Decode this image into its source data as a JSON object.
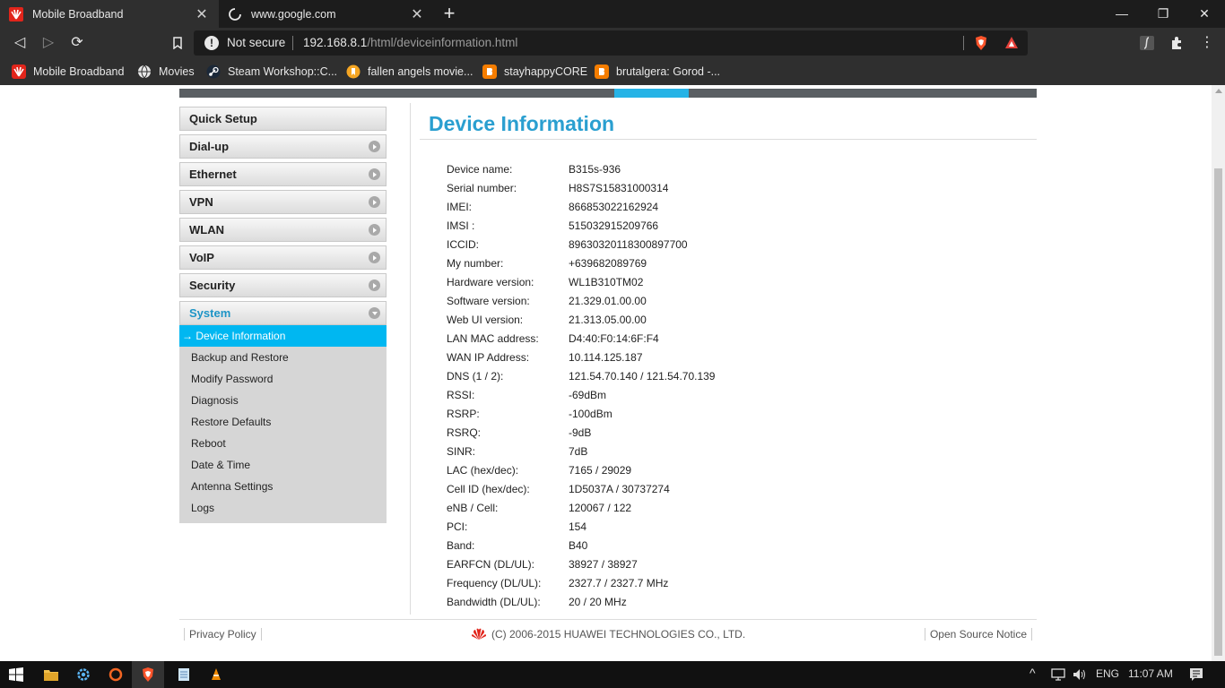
{
  "browser": {
    "tabs": [
      {
        "title": "Mobile Broadband",
        "active": true
      },
      {
        "title": "www.google.com",
        "active": false
      }
    ],
    "security_label": "Not secure",
    "url_host": "192.168.8.1",
    "url_path": "/html/deviceinformation.html",
    "bookmarks": [
      {
        "label": "Mobile Broadband",
        "icon": "huawei-icon"
      },
      {
        "label": "Movies",
        "icon": "globe-icon"
      },
      {
        "label": "Steam Workshop::C...",
        "icon": "steam-icon"
      },
      {
        "label": "fallen angels movie...",
        "icon": "bookmark-icon"
      },
      {
        "label": "stayhappyCORE",
        "icon": "blogger-icon"
      },
      {
        "label": "brutalgera: Gorod -...",
        "icon": "blogger-icon"
      }
    ]
  },
  "sidebar": {
    "items": [
      {
        "label": "Quick Setup"
      },
      {
        "label": "Dial-up"
      },
      {
        "label": "Ethernet"
      },
      {
        "label": "VPN"
      },
      {
        "label": "WLAN"
      },
      {
        "label": "VoIP"
      },
      {
        "label": "Security"
      },
      {
        "label": "System"
      }
    ],
    "active_marker": "→",
    "system_submenu": [
      {
        "label": "Device Information"
      },
      {
        "label": "Backup and Restore"
      },
      {
        "label": "Modify Password"
      },
      {
        "label": "Diagnosis"
      },
      {
        "label": "Restore Defaults"
      },
      {
        "label": "Reboot"
      },
      {
        "label": "Date & Time"
      },
      {
        "label": "Antenna Settings"
      },
      {
        "label": "Logs"
      }
    ]
  },
  "main": {
    "title": "Device Information",
    "rows": [
      {
        "label": "Device name:",
        "value": "B315s-936"
      },
      {
        "label": "Serial number:",
        "value": "H8S7S15831000314"
      },
      {
        "label": "IMEI:",
        "value": "866853022162924"
      },
      {
        "label": "IMSI :",
        "value": "515032915209766"
      },
      {
        "label": "ICCID:",
        "value": "89630320118300897700"
      },
      {
        "label": "My number:",
        "value": "+639682089769"
      },
      {
        "label": "Hardware version:",
        "value": "WL1B310TM02"
      },
      {
        "label": "Software version:",
        "value": "21.329.01.00.00"
      },
      {
        "label": "Web UI version:",
        "value": "21.313.05.00.00"
      },
      {
        "label": "LAN MAC address:",
        "value": "D4:40:F0:14:6F:F4"
      },
      {
        "label": "WAN IP Address:",
        "value": "10.114.125.187"
      },
      {
        "label": "DNS (1 / 2):",
        "value": "121.54.70.140 / 121.54.70.139"
      },
      {
        "label": "RSSI:",
        "value": "-69dBm"
      },
      {
        "label": "RSRP:",
        "value": "-100dBm"
      },
      {
        "label": "RSRQ:",
        "value": "-9dB"
      },
      {
        "label": "SINR:",
        "value": "7dB"
      },
      {
        "label": "LAC (hex/dec):",
        "value": "7165 / 29029"
      },
      {
        "label": "Cell ID (hex/dec):",
        "value": "1D5037A / 30737274"
      },
      {
        "label": "eNB / Cell:",
        "value": "120067 / 122"
      },
      {
        "label": "PCI:",
        "value": "154"
      },
      {
        "label": "Band:",
        "value": "B40"
      },
      {
        "label": "EARFCN (DL/UL):",
        "value": "38927 / 38927"
      },
      {
        "label": "Frequency (DL/UL):",
        "value": "2327.7 / 2327.7 MHz"
      },
      {
        "label": "Bandwidth (DL/UL):",
        "value": "20 / 20 MHz"
      }
    ]
  },
  "footer": {
    "privacy": "Privacy Policy",
    "copyright": "(C) 2006-2015 HUAWEI TECHNOLOGIES CO., LTD.",
    "open_source": "Open Source Notice"
  },
  "taskbar": {
    "language": "ENG",
    "time": "11:07 AM"
  },
  "colors": {
    "accent": "#2a9fd0",
    "active_menu": "#00b7f1",
    "huawei_red": "#e1251b"
  }
}
